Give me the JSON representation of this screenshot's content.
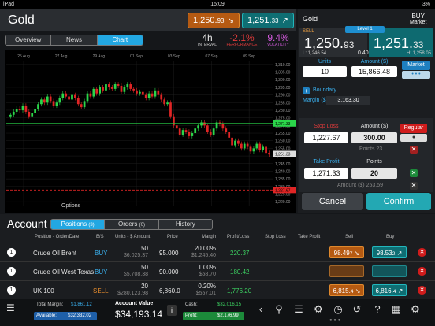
{
  "status": {
    "device": "iPad",
    "time": "15:09",
    "battery": "3%"
  },
  "instrument": {
    "name": "Gold",
    "sell_main": "1,250.",
    "sell_small": "93",
    "buy_main": "1,251.",
    "buy_small": "33"
  },
  "tabs": [
    {
      "label": "Overview"
    },
    {
      "label": "News"
    },
    {
      "label": "Chart"
    }
  ],
  "stats": {
    "interval": "4h",
    "interval_label": "INTERVAL",
    "performance": "-2.1%",
    "performance_label": "PERFORMANCE",
    "volatility": "9.4%",
    "volatility_label": "VOLATILITY"
  },
  "chart_data": {
    "type": "candlestick",
    "x_labels": [
      "25 Aug",
      "27 Aug",
      "29 Aug",
      "01 Sep",
      "03 Sep",
      "07 Sep",
      "09 Sep"
    ],
    "y_ticks": [
      "1,310.00",
      "1,305.00",
      "1,300.00",
      "1,295.00",
      "1,290.00",
      "1,285.00",
      "1,280.00",
      "1,275.00",
      "1,270.00",
      "1,265.00",
      "1,260.00",
      "1,255.00",
      "1,250.00",
      "1,245.00",
      "1,240.00",
      "1,235.00",
      "1,230.00",
      "1,225.00",
      "1,220.00"
    ],
    "ylim": [
      1217,
      1312
    ],
    "take_profit_level": "1,271.33",
    "current_level": "1,251.33",
    "stop_loss_level": "1,227.67",
    "closes": [
      1277,
      1279,
      1281,
      1280,
      1283,
      1279,
      1276,
      1278,
      1281,
      1284,
      1287,
      1285,
      1289,
      1286,
      1283,
      1285,
      1288,
      1291,
      1289,
      1287,
      1290,
      1288,
      1284,
      1282,
      1286,
      1291,
      1289,
      1294,
      1291,
      1295,
      1293,
      1297,
      1295,
      1294,
      1297,
      1296,
      1292,
      1295,
      1297,
      1294,
      1293,
      1291,
      1292,
      1290,
      1288,
      1291,
      1289,
      1293,
      1290,
      1287,
      1284,
      1285,
      1276,
      1270,
      1268,
      1264,
      1267,
      1266,
      1263,
      1265,
      1268,
      1270,
      1272,
      1270,
      1266,
      1264,
      1268,
      1272,
      1271,
      1268,
      1266,
      1262,
      1257,
      1260,
      1258,
      1255,
      1258,
      1256,
      1253,
      1255,
      1258,
      1254,
      1256,
      1252,
      1251
    ]
  },
  "options_label": "Options",
  "ticket": {
    "title": "Gold",
    "buy_label": "BUY",
    "market_label": "Market",
    "sell_label": "SELL",
    "level_label": "Level 1",
    "sell_big": "1,250.",
    "sell_small": "93",
    "spread": "0.40",
    "buy_big": "1,251.",
    "buy_small": "33",
    "low": "L: 1,246.54",
    "high": "H: 1,258.05",
    "units_label": "Units",
    "units": "10",
    "amount_label": "Amount ($)",
    "amount": "15,866.48",
    "market_btn": "Market",
    "dots": "• • •",
    "boundary": "Boundary",
    "margin_label": "Margin ($)",
    "margin": "3,163.30",
    "stop_loss_label": "Stop Loss",
    "sl_amount_label": "Amount ($)",
    "regular": "Regular",
    "stop_loss": "1,227.67",
    "sl_amount": "300.00",
    "points_line": "Points 23",
    "take_profit_label": "Take Profit",
    "tp_points_label": "Points",
    "take_profit": "1,271.33",
    "tp_points": "20",
    "amount_line": "Amount ($) 253.59",
    "cancel": "Cancel",
    "confirm": "Confirm"
  },
  "account": {
    "title": "Account",
    "tabs": [
      {
        "label": "Positions",
        "count": "(3)"
      },
      {
        "label": "Orders",
        "count": "(0)"
      },
      {
        "label": "History",
        "count": ""
      }
    ],
    "headers": [
      "Position - Order/Date",
      "B/S",
      "Units - $ Amount",
      "Price",
      "Margin",
      "Profit/Loss",
      "Stop Loss",
      "Take Profit",
      "Sell",
      "Buy"
    ],
    "rows": [
      {
        "num": "1",
        "name": "Crude Oil Brent",
        "side": "BUY",
        "units": "50",
        "amount": "$6,025.37",
        "price": "95.000",
        "margin_pct": "20.00%",
        "margin_amt": "$1,245.40",
        "pl": "220.37",
        "sell_main": "98.49",
        "sell_small": "7",
        "buy_main": "98.53",
        "buy_small": "2"
      },
      {
        "num": "1",
        "name": "Crude Oil West Texas",
        "side": "BUY",
        "units": "50",
        "amount": "$5,708.38",
        "price": "90.000",
        "margin_pct": "1.00%",
        "margin_amt": "$58.70",
        "pl": "180.42",
        "sell_main": "",
        "sell_small": "",
        "buy_main": "",
        "buy_small": ""
      },
      {
        "num": "1",
        "name": "UK 100",
        "side": "SELL",
        "units": "20",
        "amount": "$280,123.98",
        "price": "6,860.0",
        "margin_pct": "0.20%",
        "margin_amt": "$557.01",
        "pl": "1,776.20",
        "sell_main": "6,815.",
        "sell_small": "4",
        "buy_main": "6,816.",
        "buy_small": "4"
      }
    ]
  },
  "footer": {
    "total_margin_label": "Total Margin:",
    "total_margin": "$1,861.12",
    "available_label": "Available:",
    "available": "$32,332.02",
    "account_value_label": "Account Value",
    "account_value": "$34,193.14",
    "cash_label": "Cash:",
    "cash": "$32,016.15",
    "profit_label": "Profit:",
    "profit": "$2,176.99"
  }
}
